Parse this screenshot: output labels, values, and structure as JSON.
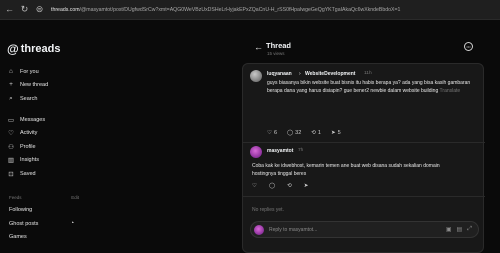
{
  "browser": {
    "url_host": "threads.com",
    "url_path": "/@masyamtot/post/DUgfwdSrCw?xmt=AQG0WeVBzUxDSHeLrHyjakEPxZQaCnU-H_rSS0fHpaIwgeGeQgYKTgaIAkaQc6wXkndeBbdoX=1"
  },
  "brand": {
    "logo_text": "threads",
    "accent": "#c13584"
  },
  "sidebar": {
    "items": [
      {
        "icon": "home-icon",
        "glyph": "⌂",
        "label": "For you"
      },
      {
        "icon": "plus-icon",
        "glyph": "+",
        "label": "New thread"
      },
      {
        "icon": "search-icon",
        "glyph": "⌕",
        "label": "Search"
      },
      {
        "icon": "messages-icon",
        "glyph": "▭",
        "label": "Messages"
      },
      {
        "icon": "heart-icon",
        "glyph": "♡",
        "label": "Activity"
      },
      {
        "icon": "profile-icon",
        "glyph": "⚇",
        "label": "Profile"
      },
      {
        "icon": "insights-icon",
        "glyph": "▥",
        "label": "Insights"
      },
      {
        "icon": "saved-icon",
        "glyph": "⊡",
        "label": "Saved"
      }
    ],
    "feeds_heading": "Feeds",
    "feeds_edit": "Edit",
    "feeds": [
      "Following",
      "Ghost posts",
      "Games"
    ]
  },
  "thread": {
    "title": "Thread",
    "views": "15 views",
    "post": {
      "username": "luqyanaan",
      "separator": "›",
      "community": "WebsiteDevelopment",
      "time": "11h",
      "text": "guys biasanya bikin website buat bisnis itu habis berapa ya? ada yang bisa kasih gambaran berapa dana yang harus disiapin? gue bener2 newbie dalam website building",
      "translate": "Translate",
      "likes": "6",
      "comments": "32",
      "reposts": "1",
      "shares": "5"
    },
    "reply": {
      "username": "masyamtot",
      "time": "7h",
      "text": "Coba kak ke idwebhost, kemarin temen ane buat web disana sudah sekalian domain hostingnya tinggal beres"
    },
    "no_replies": "No replies yet.",
    "reply_placeholder": "Reply to masyamtot..."
  }
}
